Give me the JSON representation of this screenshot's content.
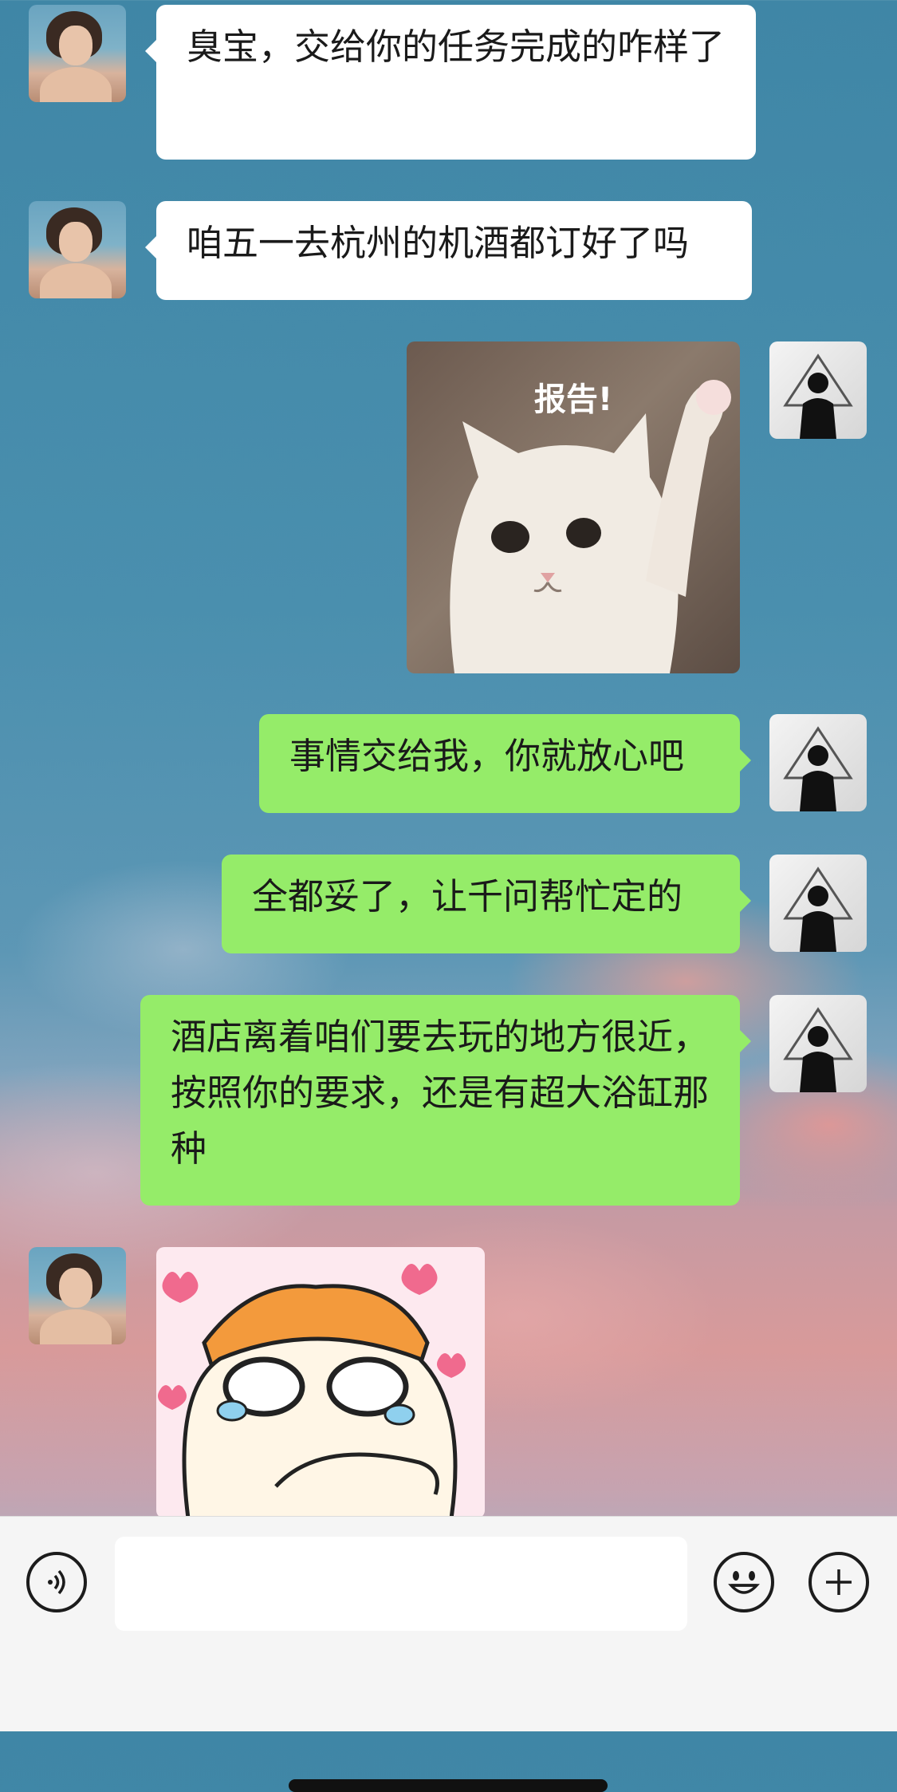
{
  "messages": [
    {
      "sender": "other",
      "type": "text",
      "text": "臭宝，交给你的任务完成的咋样了"
    },
    {
      "sender": "other",
      "type": "text",
      "text": "咱五一去杭州的机酒都订好了吗"
    },
    {
      "sender": "self",
      "type": "sticker",
      "caption": "报告!",
      "sticker": "cat-raising-paw"
    },
    {
      "sender": "self",
      "type": "text",
      "text": "事情交给我，你就放心吧"
    },
    {
      "sender": "self",
      "type": "text",
      "text": "全都妥了，让千问帮忙定的"
    },
    {
      "sender": "self",
      "type": "text",
      "text": "酒店离着咱们要去玩的地方很近，按照你的要求，还是有超大浴缸那种"
    },
    {
      "sender": "other",
      "type": "sticker",
      "sticker": "hamster-crying-hearts"
    }
  ],
  "input_bar": {
    "voice_icon": "voice-icon",
    "input_value": "",
    "emoji_icon": "emoji-icon",
    "plus_icon": "plus-icon"
  },
  "colors": {
    "outgoing_bubble": "#95ec69",
    "incoming_bubble": "#ffffff",
    "input_bar_bg": "#f5f5f5"
  }
}
